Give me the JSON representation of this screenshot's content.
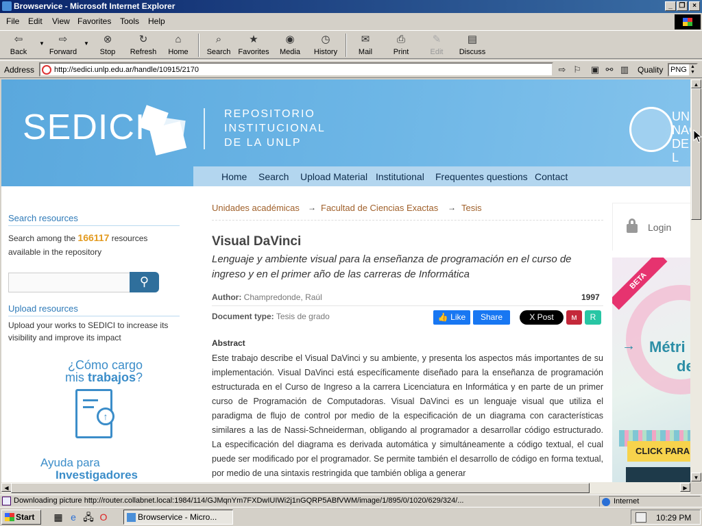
{
  "window": {
    "title": "Browservice - Microsoft Internet Explorer"
  },
  "menu": [
    "File",
    "Edit",
    "View",
    "Favorites",
    "Tools",
    "Help"
  ],
  "toolbar": {
    "back": "Back",
    "forward": "Forward",
    "stop": "Stop",
    "refresh": "Refresh",
    "home": "Home",
    "search": "Search",
    "favorites": "Favorites",
    "media": "Media",
    "history": "History",
    "mail": "Mail",
    "print": "Print",
    "edit": "Edit",
    "discuss": "Discuss"
  },
  "address": {
    "label": "Address",
    "url": "http://sedici.unlp.edu.ar/handle/10915/2170",
    "quality_label": "Quality",
    "quality_value": "PNG"
  },
  "site": {
    "logo": "SEDICI",
    "subtitle": [
      "REPOSITORIO",
      "INSTITUCIONAL",
      "DE LA UNLP"
    ],
    "university": [
      "UNI",
      "NAC",
      "DE L"
    ],
    "nav": [
      "Home",
      "Search",
      "Upload Material",
      "Institutional",
      "Frequentes questions",
      "Contact"
    ]
  },
  "sidebar": {
    "search_heading": "Search resources",
    "search_text_before": "Search among the",
    "count": "166117",
    "search_text_after": "resources available in the repository",
    "upload_heading": "Upload resources",
    "upload_text": "Upload your works to SEDICI to increase its visibility and improve its impact",
    "promo1_line1": "¿Cómo cargo",
    "promo1_line2a": "mis",
    "promo1_line2b": "trabajos",
    "promo1_line2c": "?",
    "promo2_line1": "Ayuda para",
    "promo2_line2": "Investigadores"
  },
  "breadcrumb": [
    "Unidades académicas",
    "Facultad de Ciencias Exactas",
    "Tesis"
  ],
  "record": {
    "title": "Visual DaVinci",
    "subtitle": "Lenguaje y ambiente visual para la enseñanza de programación en el curso de ingreso y en el primer año de las carreras de Informática",
    "author_label": "Author:",
    "author": "Champredonde, Raúl",
    "year": "1997",
    "doctype_label": "Document type:",
    "doctype": "Tesis de grado",
    "abstract_heading": "Abstract",
    "abstract": "Este trabajo describe el Visual DaVinci y su ambiente, y presenta los aspectos más importantes de su implementación. Visual DaVinci está específicamente diseñado para la enseñanza de programación estructurada en el Curso de Ingreso a la carrera Licenciatura en Informática y en parte de un primer curso de Programación de Computadoras. Visual DaVinci es un lenguaje visual que utiliza el paradigma de flujo de control por medio de la especificación de un diagrama con características similares a las de Nassi-Schneiderman, obligando al programador a desarrollar código estructurado. La especificación del diagrama es derivada automática y simultáneamente a código textual, el cual puede ser modificado por el programador. Se permite también el desarrollo de código en forma textual, por medio de una sintaxis restringida que también obliga a generar"
  },
  "social": {
    "like": "Like",
    "share": "Share",
    "post": "X Post",
    "rg": "R"
  },
  "right": {
    "login": "Login",
    "beta": "BETA",
    "metric": "Métri",
    "de": "de",
    "click": "CLICK PARA"
  },
  "status": {
    "text": "Downloading picture http://router.collabnet.local:1984/114/GJMqnYm7FXDwIUIWi2j1nGQRP5ABfVWM/image/1/895/0/1020/629/324/...",
    "zone": "Internet"
  },
  "taskbar": {
    "start": "Start",
    "task": "Browservice - Micro...",
    "clock": "10:29 PM"
  }
}
